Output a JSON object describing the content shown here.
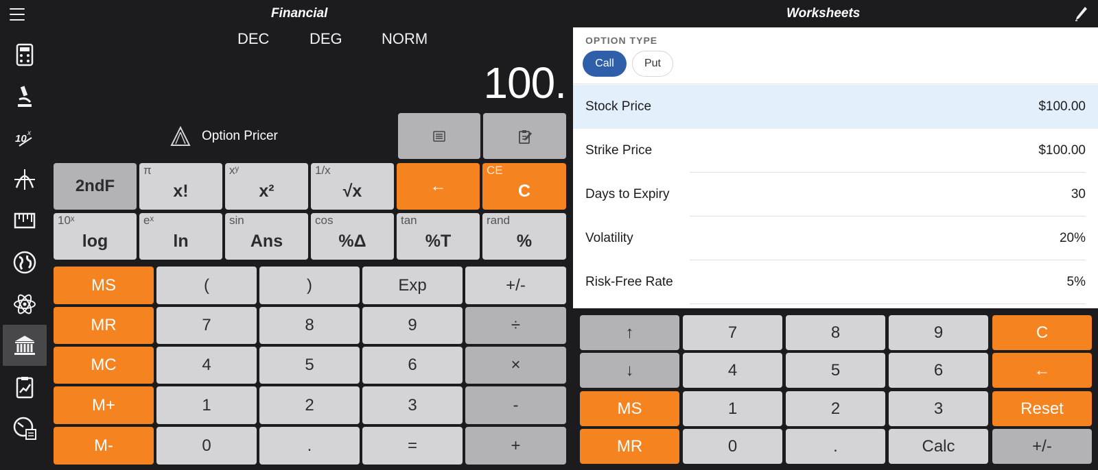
{
  "header": {
    "left_title": "Financial",
    "right_title": "Worksheets"
  },
  "sidebar": {
    "items": [
      {
        "icon": "calculator-icon"
      },
      {
        "icon": "microscope-icon"
      },
      {
        "icon": "exponent-10x-icon"
      },
      {
        "icon": "graph-icon"
      },
      {
        "icon": "ruler-icon"
      },
      {
        "icon": "globe-icon"
      },
      {
        "icon": "atom-icon"
      },
      {
        "icon": "bank-icon",
        "active": true
      },
      {
        "icon": "report-chart-icon"
      },
      {
        "icon": "clock-calculator-icon"
      }
    ]
  },
  "calculator": {
    "modes": [
      "DEC",
      "DEG",
      "NORM"
    ],
    "display": "100.",
    "pricer_label": "Option Pricer",
    "sci_row1": [
      {
        "main": "2ndF",
        "sec": ""
      },
      {
        "main": "x!",
        "sec": "π"
      },
      {
        "main": "x²",
        "sec": "xʸ"
      },
      {
        "main": "√x",
        "sec": "1/x"
      },
      {
        "main": "←",
        "sec": ""
      },
      {
        "main": "C",
        "sec": "CE"
      }
    ],
    "sci_row2": [
      {
        "main": "log",
        "sec": "10ˣ"
      },
      {
        "main": "ln",
        "sec": "eˣ"
      },
      {
        "main": "Ans",
        "sec": "sin"
      },
      {
        "main": "%Δ",
        "sec": "cos"
      },
      {
        "main": "%T",
        "sec": "tan"
      },
      {
        "main": "%",
        "sec": "rand"
      }
    ],
    "memory": [
      "MS",
      "MR",
      "MC",
      "M+",
      "M-"
    ],
    "grid": [
      [
        "(",
        ")",
        "Exp",
        "+/-"
      ],
      [
        "7",
        "8",
        "9",
        "÷"
      ],
      [
        "4",
        "5",
        "6",
        "×"
      ],
      [
        "1",
        "2",
        "3",
        "-"
      ],
      [
        "0",
        ".",
        "=",
        "+"
      ]
    ]
  },
  "worksheet": {
    "option_type_label": "OPTION TYPE",
    "call_label": "Call",
    "put_label": "Put",
    "rows": [
      {
        "label": "Stock Price",
        "value": "$100.00"
      },
      {
        "label": "Strike Price",
        "value": "$100.00"
      },
      {
        "label": "Days to Expiry",
        "value": "30"
      },
      {
        "label": "Volatility",
        "value": "20%"
      },
      {
        "label": "Risk-Free Rate",
        "value": "5%"
      }
    ]
  },
  "keypad": {
    "rows": [
      [
        "↑",
        "7",
        "8",
        "9",
        "C"
      ],
      [
        "↓",
        "4",
        "5",
        "6",
        "←"
      ],
      [
        "MS",
        "1",
        "2",
        "3",
        "Reset"
      ],
      [
        "MR",
        "0",
        ".",
        "Calc",
        "+/-"
      ]
    ]
  },
  "colors": {
    "accent_orange": "#f5831f",
    "selected_blue": "#2e5fa8",
    "row_highlight": "#e3f0fb"
  }
}
